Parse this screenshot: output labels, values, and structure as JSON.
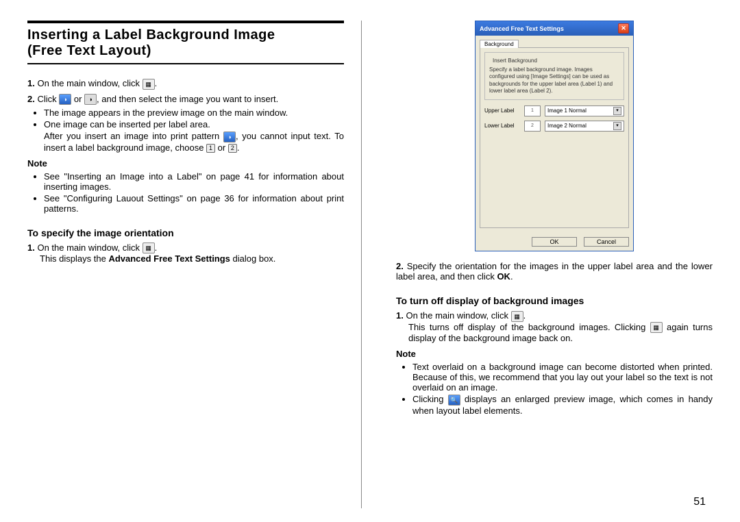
{
  "page_number": "51",
  "left": {
    "heading_line1": "Inserting a Label Background Image",
    "heading_line2": "(Free Text Layout)",
    "step1": {
      "num": "1.",
      "text": "On the main window, click ",
      "tail": "."
    },
    "step2": {
      "num": "2.",
      "prefix": "Click ",
      "mid": " or ",
      "suffix": ", and then select the image you want to insert.",
      "b1": "The image appears in the preview image on the main window.",
      "b2": "One image can be inserted per label area.",
      "b3a": "After you insert an image into print pattern ",
      "b3b": ", you cannot input text. To insert a label background image, choose ",
      "or": " or ",
      "b3c": "."
    },
    "note_label": "Note",
    "note_b1": "See \"Inserting an Image into a Label\" on page 41 for information about inserting images.",
    "note_b2": "See \"Configuring Lauout Settings\" on page 36 for information about print patterns.",
    "h2": "To specify the image orientation",
    "orient_step1": {
      "num": "1.",
      "text": "On the main window, click ",
      "tail": "."
    },
    "orient_step1_sub": "This displays the ",
    "orient_step1_bold": "Advanced Free Text Settings",
    "orient_step1_sub_tail": " dialog box."
  },
  "right": {
    "dialog": {
      "title": "Advanced Free Text Settings",
      "tab": "Background",
      "group": "Insert Background",
      "desc": "Specify a label background image. Images configured using [Image Settings] can be used as backgrounds for the upper label area (Label 1) and lower label area (Label 2).",
      "upper_label": "Upper Label",
      "upper_value": "Image 1 Normal",
      "lower_label": "Lower Label",
      "lower_value": "Image 2 Normal",
      "ok": "OK",
      "cancel": "Cancel"
    },
    "step2": {
      "num": "2.",
      "text": "Specify the orientation for the images in the upper label area and the lower label area, and then click ",
      "ok": "OK",
      "tail": "."
    },
    "h2": "To turn off display of background images",
    "off_step1": {
      "num": "1.",
      "text": "On the main window, click ",
      "tail": ".",
      "sub1": "This turns off display of the background images. Clicking ",
      "sub2": " again turns display of the background image back on."
    },
    "note_label": "Note",
    "note_b1": "Text overlaid on a background image can become distorted when printed. Because of this, we recommend that you lay out your label so the text is not overlaid on an image.",
    "note_b2a": "Clicking ",
    "note_b2b": " displays an enlarged preview image, which comes in handy when layout label elements."
  }
}
